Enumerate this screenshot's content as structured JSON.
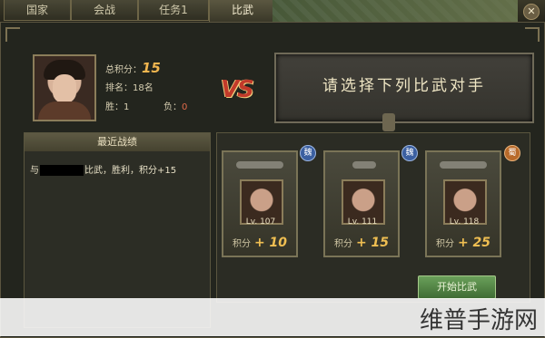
{
  "tabs": [
    "国家",
    "会战",
    "任务1",
    "比武"
  ],
  "close_glyph": "✕",
  "profile": {
    "total_score_label": "总积分：",
    "total_score": "15",
    "rank_text": "排名：18名",
    "win_text": "胜：1",
    "loss_label": "负：",
    "loss_value": "0"
  },
  "vs_text": "VS",
  "banner_text": "请选择下列比武对手",
  "recent": {
    "title": "最近战绩",
    "record_prefix": "与",
    "record_suffix": "比武，胜利，积分+15"
  },
  "opponents": [
    {
      "level": "Lv. 107",
      "score_label": "积分",
      "score": "+ 10",
      "badge": "魏",
      "badge_color": "#3b5fa0"
    },
    {
      "level": "Lv. 111",
      "score_label": "积分",
      "score": "+ 15",
      "badge": "魏",
      "badge_color": "#3b5fa0"
    },
    {
      "level": "Lv. 118",
      "score_label": "积分",
      "score": "+ 25",
      "badge": "蜀",
      "badge_color": "#b86a2a"
    }
  ],
  "start_button": "开始比武",
  "watermark": "维普手游网"
}
